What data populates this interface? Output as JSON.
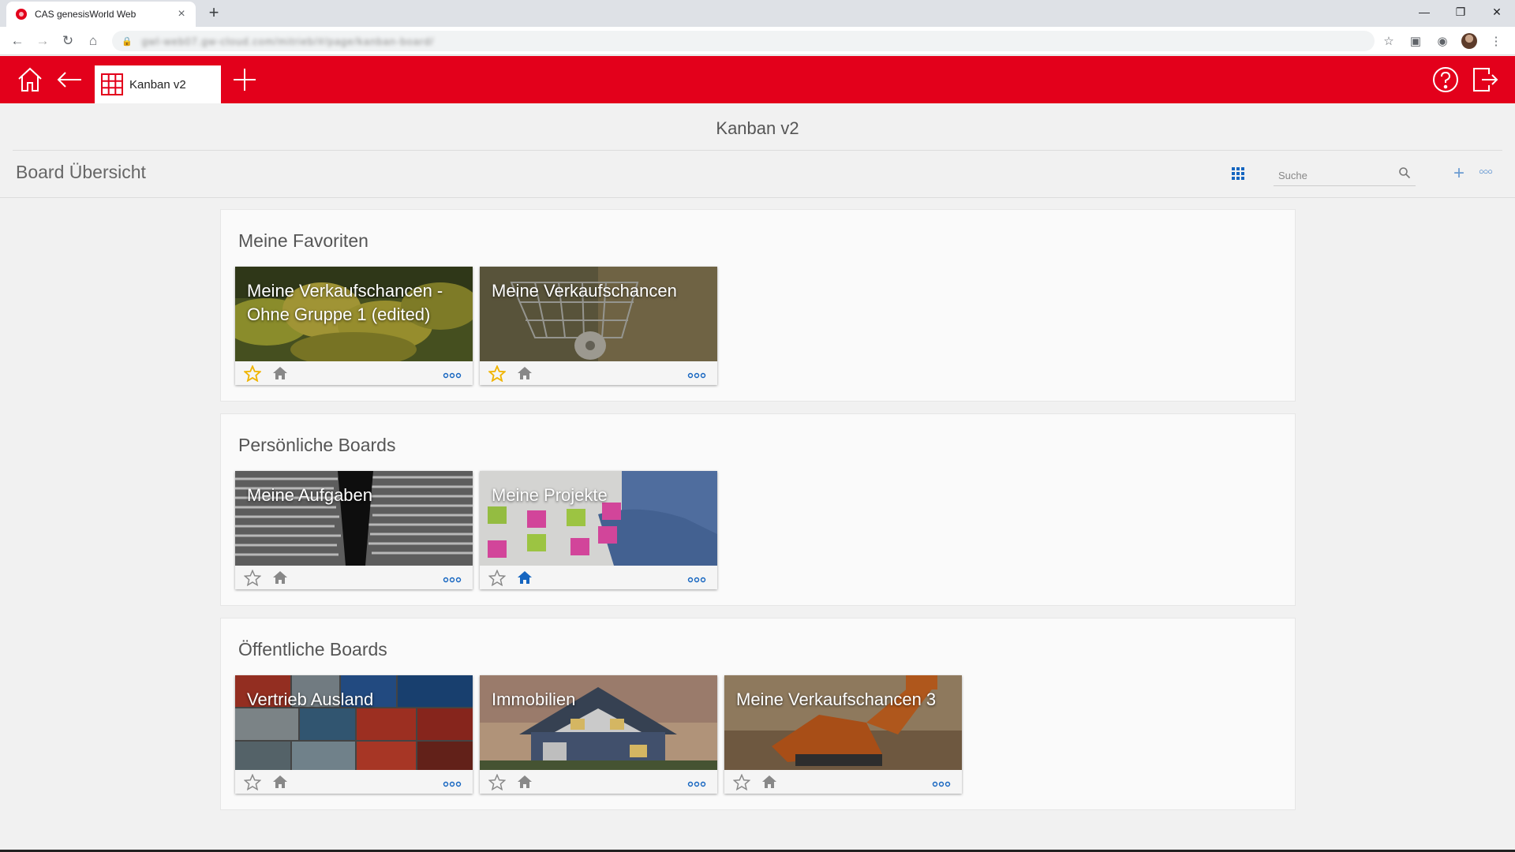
{
  "browser": {
    "tab_title": "CAS genesisWorld Web",
    "url_blurred": "gwl-web07.gw-cloud.com/mitrieb/#/page/kanban-board/",
    "new_tab": "+",
    "close": "×"
  },
  "app": {
    "tab_label": "Kanban v2",
    "page_title": "Kanban v2",
    "board_overview": "Board Übersicht",
    "search_placeholder": "Suche",
    "accent_color": "#e3001b",
    "link_color": "#1565c0"
  },
  "sections": [
    {
      "title": "Meine Favoriten",
      "cards": [
        {
          "title": "Meine Verkaufschancen - Ohne Gruppe 1 (edited)",
          "favorite": true,
          "home": false,
          "image": "bananas"
        },
        {
          "title": "Meine Verkaufschancen",
          "favorite": true,
          "home": false,
          "image": "shopping-cart"
        }
      ]
    },
    {
      "title": "Persönliche Boards",
      "cards": [
        {
          "title": "Meine Aufgaben",
          "favorite": false,
          "home": false,
          "image": "paper-stacks"
        },
        {
          "title": "Meine Projekte",
          "favorite": false,
          "home": true,
          "image": "kanban-desk"
        }
      ]
    },
    {
      "title": "Öffentliche Boards",
      "cards": [
        {
          "title": "Vertrieb Ausland",
          "favorite": false,
          "home": false,
          "image": "containers"
        },
        {
          "title": "Immobilien",
          "favorite": false,
          "home": false,
          "image": "house"
        },
        {
          "title": "Meine Verkaufschancen 3",
          "favorite": false,
          "home": false,
          "image": "excavator"
        }
      ]
    }
  ]
}
